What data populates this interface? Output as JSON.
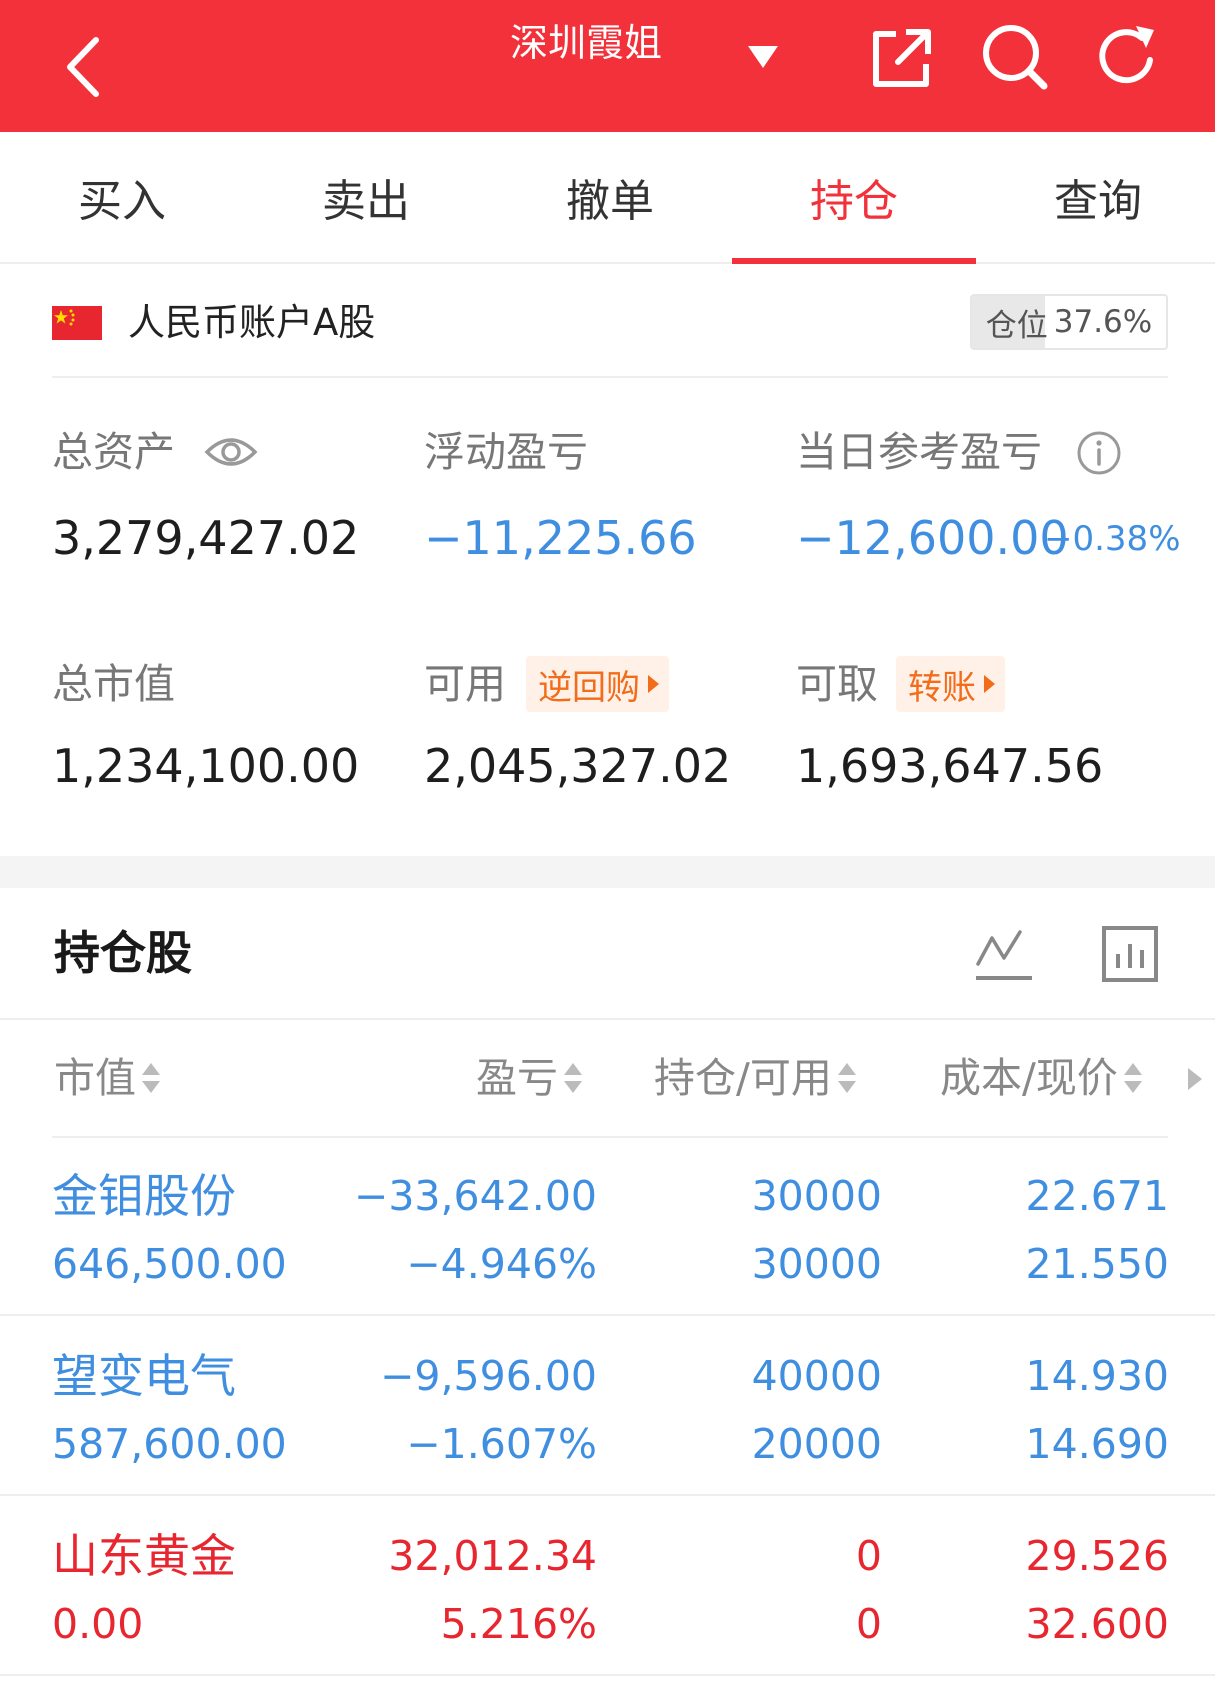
{
  "header": {
    "title": "深圳霞姐",
    "bg_color": "#f2313b",
    "icons": [
      "back-icon",
      "caret-down-icon",
      "share-icon",
      "search-icon",
      "refresh-icon"
    ]
  },
  "tabs": [
    {
      "label": "买入"
    },
    {
      "label": "卖出"
    },
    {
      "label": "撤单"
    },
    {
      "label": "持仓",
      "active": true
    },
    {
      "label": "查询"
    }
  ],
  "account": {
    "name": "人民币账户A股",
    "position_label": "仓位",
    "position_value": "37.6%",
    "position_ratio": 0.376
  },
  "summary": {
    "total_assets_label": "总资产",
    "total_assets": "3,279,427.02",
    "floating_pnl_label": "浮动盈亏",
    "floating_pnl": "−11,225.66",
    "daily_pnl_label": "当日参考盈亏",
    "daily_pnl": "−12,600.00",
    "daily_pnl_pct": "−0.38%",
    "market_value_label": "总市值",
    "market_value": "1,234,100.00",
    "available_label": "可用",
    "available_tag": "逆回购",
    "available": "2,045,327.02",
    "withdrawable_label": "可取",
    "withdrawable_tag": "转账",
    "withdrawable": "1,693,647.56"
  },
  "holdings": {
    "title": "持仓股",
    "columns": [
      "市值",
      "盈亏",
      "持仓/可用",
      "成本/现价"
    ],
    "rows": [
      {
        "name": "金钼股份",
        "market_value": "646,500.00",
        "pnl": "−33,642.00",
        "pnl_pct": "−4.946%",
        "position": "30000",
        "available": "30000",
        "cost": "22.671",
        "price": "21.550",
        "color": "blue"
      },
      {
        "name": "望变电气",
        "market_value": "587,600.00",
        "pnl": "−9,596.00",
        "pnl_pct": "−1.607%",
        "position": "40000",
        "available": "20000",
        "cost": "14.930",
        "price": "14.690",
        "color": "blue"
      },
      {
        "name": "山东黄金",
        "market_value": "0.00",
        "pnl": "32,012.34",
        "pnl_pct": "5.216%",
        "position": "0",
        "available": "0",
        "cost": "29.526",
        "price": "32.600",
        "color": "red"
      }
    ]
  },
  "colors": {
    "accent": "#f2313b",
    "loss": "#3f8ee0",
    "gain": "#e8262f",
    "tag": "#f26c1a"
  }
}
